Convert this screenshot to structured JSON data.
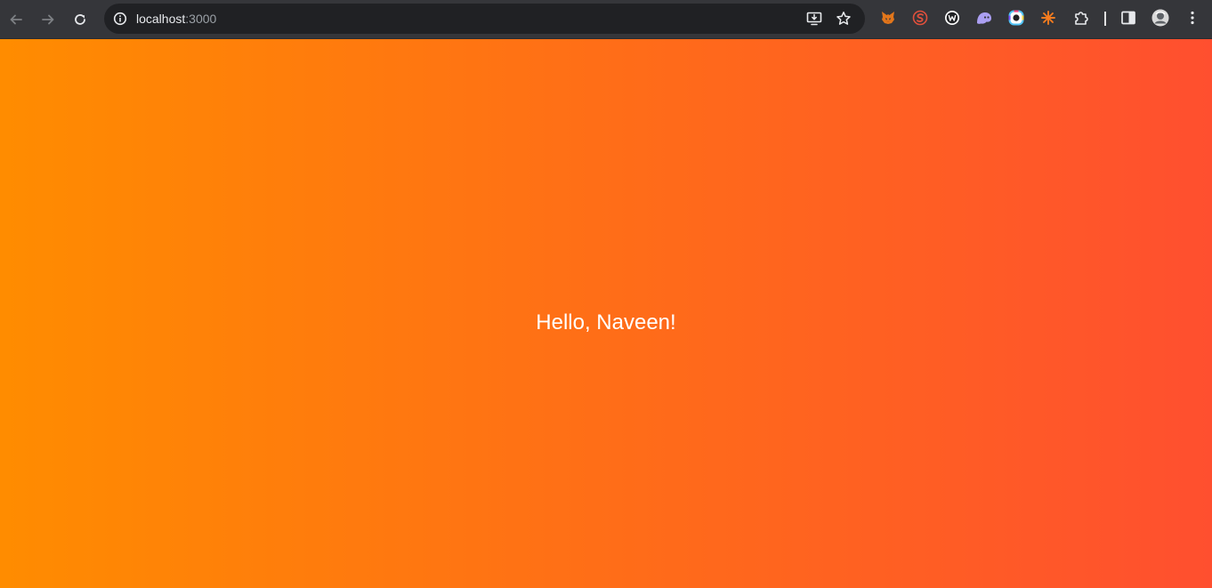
{
  "browser": {
    "address_bar": {
      "host": "localhost",
      "port": ":3000"
    },
    "icons": {
      "back": "arrow-left-icon",
      "forward": "arrow-right-icon",
      "reload": "reload-icon",
      "site_info": "info-icon",
      "install": "install-app-icon",
      "bookmark": "star-icon",
      "extensions": [
        "metamask-fox-icon",
        "swirl-s-icon",
        "w-circle-icon",
        "ghost-icon",
        "color-ring-icon",
        "spark-icon"
      ],
      "puzzle": "puzzle-icon",
      "side_panel": "side-panel-icon",
      "profile": "avatar",
      "menu": "kebab-menu-icon"
    },
    "colors": {
      "toolbar": "#35363a",
      "omnibox": "#202124"
    }
  },
  "page": {
    "greeting": "Hello, Naveen!",
    "gradient": {
      "from": "#ff8c00",
      "to": "#ff4f2f"
    }
  }
}
